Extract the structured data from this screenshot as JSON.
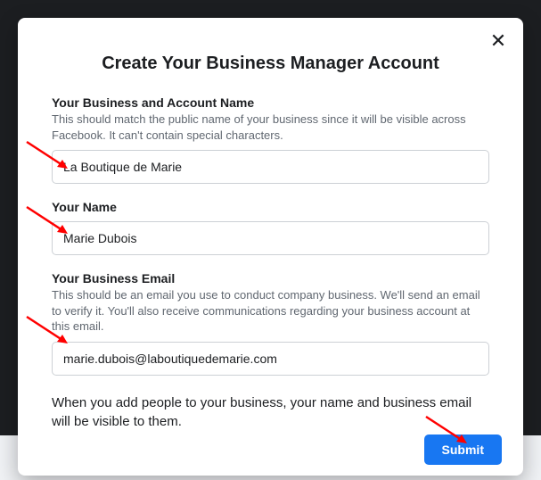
{
  "modal": {
    "title": "Create Your Business Manager Account",
    "close_label": "✕"
  },
  "fields": {
    "business_name": {
      "label": "Your Business and Account Name",
      "help": "This should match the public name of your business since it will be visible across Facebook. It can't contain special characters.",
      "value": "La Boutique de Marie"
    },
    "your_name": {
      "label": "Your Name",
      "value": "Marie Dubois"
    },
    "email": {
      "label": "Your Business Email",
      "help": "This should be an email you use to conduct company business. We'll send an email to verify it. You'll also receive communications regarding your business account at this email.",
      "value": "marie.dubois@laboutiquedemarie.com"
    }
  },
  "disclosure": "When you add people to your business, your name and business email will be visible to them.",
  "submit_label": "Submit"
}
